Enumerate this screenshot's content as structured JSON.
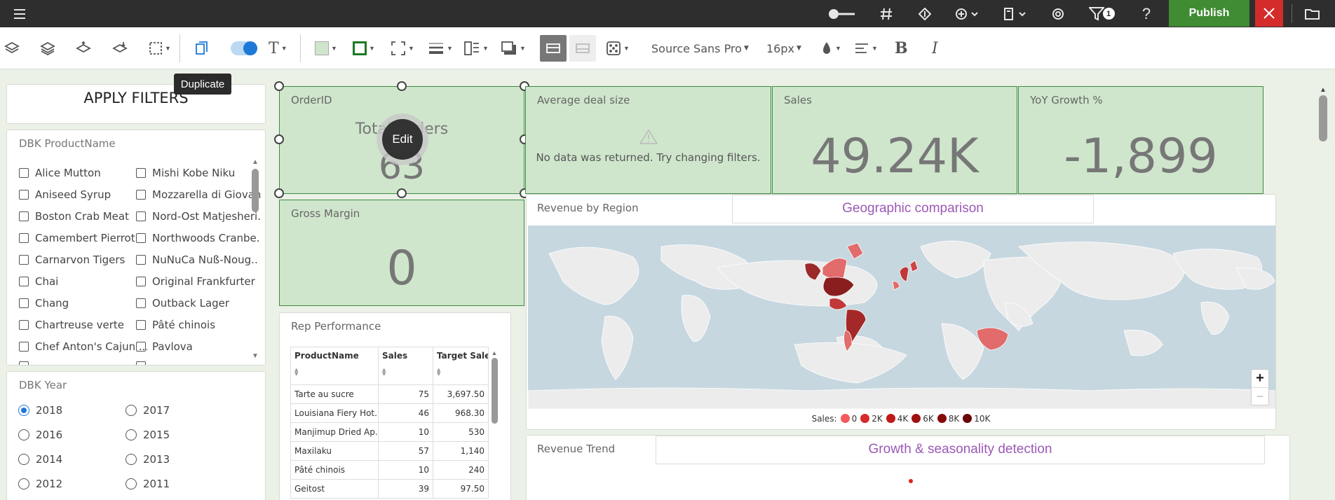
{
  "topbar": {
    "filter_badge": "1",
    "publish_label": "Publish"
  },
  "toolbar": {
    "font_family": "Source Sans Pro",
    "font_size": "16px",
    "tooltip": "Duplicate"
  },
  "filters": {
    "title": "APPLY FILTERS",
    "product_panel_title": "DBK ProductName",
    "products_col1": [
      "Alice Mutton",
      "Aniseed Syrup",
      "Boston Crab Meat",
      "Camembert Pierrot",
      "Carnarvon Tigers",
      "Chai",
      "Chang",
      "Chartreuse verte",
      "Chef Anton's Cajun ..."
    ],
    "products_col2": [
      "Mishi Kobe Niku",
      "Mozzarella di Giovan",
      "Nord-Ost Matjesheri.",
      "Northwoods Cranbe.",
      "NuNuCa Nuß-Noug..",
      "Original Frankfurter",
      "Outback Lager",
      "Pâté chinois",
      "Pavlova"
    ],
    "year_panel_title": "DBK Year",
    "years": [
      {
        "label": "2018",
        "selected": true
      },
      {
        "label": "2017",
        "selected": false
      },
      {
        "label": "2016",
        "selected": false
      },
      {
        "label": "2015",
        "selected": false
      },
      {
        "label": "2014",
        "selected": false
      },
      {
        "label": "2013",
        "selected": false
      },
      {
        "label": "2012",
        "selected": false
      },
      {
        "label": "2011",
        "selected": false
      }
    ]
  },
  "kpis": {
    "orderid": {
      "title": "OrderID",
      "subtitle": "Total Orders",
      "value": "63",
      "edit_label": "Edit"
    },
    "avg_deal": {
      "title": "Average deal size",
      "message": "No data was returned. Try changing filters."
    },
    "sales": {
      "title": "Sales",
      "value": "49.24K"
    },
    "yoy": {
      "title": "YoY Growth %",
      "value": "-1,899"
    },
    "gross_margin": {
      "title": "Gross Margin",
      "value": "0"
    }
  },
  "rep_performance": {
    "title": "Rep Performance",
    "columns": [
      "ProductName",
      "Sales",
      "Target Sales"
    ],
    "rows": [
      [
        "Tarte au sucre",
        "75",
        "3,697.50"
      ],
      [
        "Louisiana Fiery Hot...",
        "46",
        "968.30"
      ],
      [
        "Manjimup Dried Ap...",
        "10",
        "530"
      ],
      [
        "Maxilaku",
        "57",
        "1,140"
      ],
      [
        "Pâté chinois",
        "10",
        "240"
      ],
      [
        "Geitost",
        "39",
        "97.50"
      ]
    ]
  },
  "revenue_region": {
    "title": "Revenue by Region",
    "subtitle": "Geographic comparison",
    "zoom_in": "+",
    "zoom_out": "−",
    "legend_label": "Sales:",
    "legend": [
      {
        "label": "0",
        "color": "#f25c5c"
      },
      {
        "label": "2K",
        "color": "#d92a2a"
      },
      {
        "label": "4K",
        "color": "#c01818"
      },
      {
        "label": "6K",
        "color": "#a01010"
      },
      {
        "label": "8K",
        "color": "#850b0b"
      },
      {
        "label": "10K",
        "color": "#6b0606"
      }
    ]
  },
  "revenue_trend": {
    "title": "Revenue Trend",
    "subtitle": "Growth & seasonality detection"
  }
}
